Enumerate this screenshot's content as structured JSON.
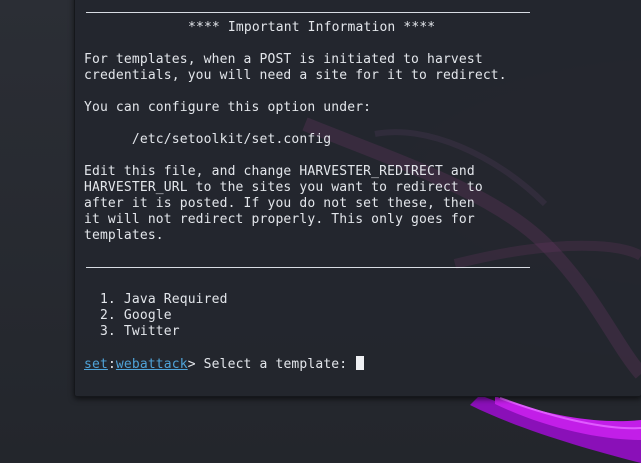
{
  "terminal": {
    "header_title": "**** Important Information ****",
    "paragraph1": [
      "For templates, when a POST is initiated to harvest",
      "credentials, you will need a site for it to redirect."
    ],
    "paragraph2": "You can configure this option under:",
    "config_path": "      /etc/setoolkit/set.config",
    "paragraph3": [
      "Edit this file, and change HARVESTER_REDIRECT and",
      "HARVESTER_URL to the sites you want to redirect to",
      "after it is posted. If you do not set these, then",
      "it will not redirect properly. This only goes for",
      "templates."
    ],
    "menu": [
      "  1. Java Required",
      "  2. Google",
      "  3. Twitter"
    ],
    "prompt": {
      "set": "set",
      "colon": ":",
      "module": "webattack",
      "text": "> Select a template: "
    }
  },
  "colors": {
    "prompt_accent": "#4fa3d8",
    "terminal_text": "#e3e6eb",
    "wallpaper_swoosh": "#b114d6"
  }
}
